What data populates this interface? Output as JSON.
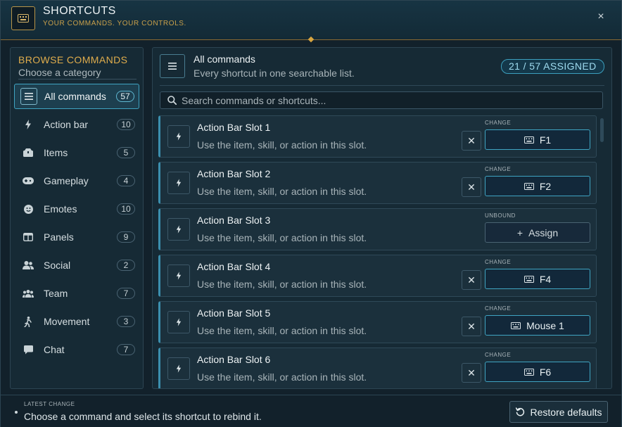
{
  "header": {
    "title": "SHORTCUTS",
    "subtitle": "YOUR COMMANDS. YOUR CONTROLS.",
    "close_label": "×"
  },
  "sidebar": {
    "heading": "BROWSE COMMANDS",
    "subheading": "Choose a category",
    "items": [
      {
        "label": "All commands",
        "count": "57",
        "icon": "list-icon"
      },
      {
        "label": "Action bar",
        "count": "10",
        "icon": "lightning-icon"
      },
      {
        "label": "Items",
        "count": "5",
        "icon": "box-icon"
      },
      {
        "label": "Gameplay",
        "count": "4",
        "icon": "gamepad-icon"
      },
      {
        "label": "Emotes",
        "count": "10",
        "icon": "smile-icon"
      },
      {
        "label": "Panels",
        "count": "9",
        "icon": "panel-icon"
      },
      {
        "label": "Social",
        "count": "2",
        "icon": "people-icon"
      },
      {
        "label": "Team",
        "count": "7",
        "icon": "team-icon"
      },
      {
        "label": "Movement",
        "count": "3",
        "icon": "walk-icon"
      },
      {
        "label": "Chat",
        "count": "7",
        "icon": "chat-bubble-icon"
      }
    ]
  },
  "main": {
    "title": "All commands",
    "subtitle": "Every shortcut in one searchable list.",
    "assigned": "21 / 57 ASSIGNED",
    "search_placeholder": "Search commands or shortcuts...",
    "rows": [
      {
        "name": "Action Bar Slot 1",
        "desc": "Use the item, skill, or action in this slot.",
        "state": "CHANGE",
        "key": "F1",
        "bound": true
      },
      {
        "name": "Action Bar Slot 2",
        "desc": "Use the item, skill, or action in this slot.",
        "state": "CHANGE",
        "key": "F2",
        "bound": true
      },
      {
        "name": "Action Bar Slot 3",
        "desc": "Use the item, skill, or action in this slot.",
        "state": "UNBOUND",
        "key": "Assign",
        "bound": false
      },
      {
        "name": "Action Bar Slot 4",
        "desc": "Use the item, skill, or action in this slot.",
        "state": "CHANGE",
        "key": "F4",
        "bound": true
      },
      {
        "name": "Action Bar Slot 5",
        "desc": "Use the item, skill, or action in this slot.",
        "state": "CHANGE",
        "key": "Mouse 1",
        "bound": true
      },
      {
        "name": "Action Bar Slot 6",
        "desc": "Use the item, skill, or action in this slot.",
        "state": "CHANGE",
        "key": "F6",
        "bound": true
      }
    ]
  },
  "footer": {
    "label": "LATEST CHANGE",
    "message": "Choose a command and select its shortcut to rebind it.",
    "restore_label": "Restore defaults"
  },
  "colors": {
    "accent": "#3fa4c2",
    "gold": "#e0ad4c",
    "background": "#12212b"
  }
}
